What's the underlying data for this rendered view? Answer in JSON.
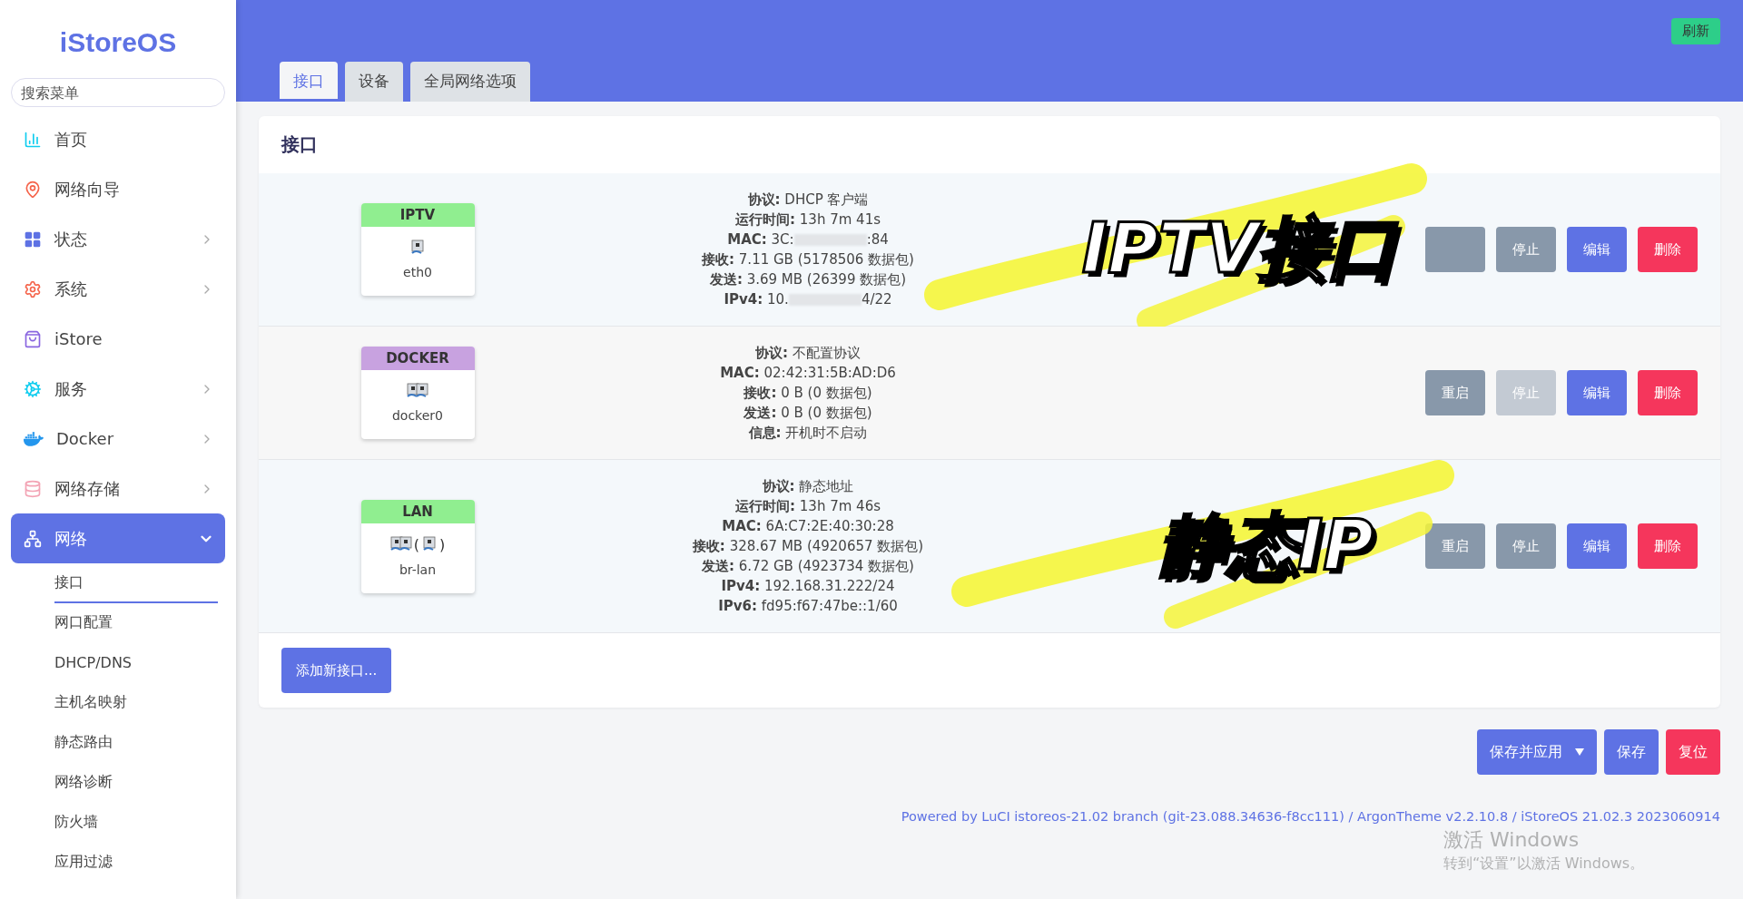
{
  "brand": "iStoreOS",
  "search": {
    "placeholder": "搜索菜单"
  },
  "sidebar": {
    "items": [
      {
        "label": "首页",
        "kind": "home",
        "selected": false
      },
      {
        "label": "网络向导",
        "kind": "wizard",
        "selected": false
      },
      {
        "label": "状态",
        "kind": "status",
        "expanded": false,
        "selected": false
      },
      {
        "label": "系统",
        "kind": "system",
        "expanded": false,
        "selected": false
      },
      {
        "label": "iStore",
        "kind": "store",
        "selected": false
      },
      {
        "label": "服务",
        "kind": "services",
        "expanded": false,
        "selected": false
      },
      {
        "label": "Docker",
        "kind": "docker",
        "expanded": false,
        "selected": false
      },
      {
        "label": "网络存储",
        "kind": "storage",
        "expanded": false,
        "selected": false
      },
      {
        "label": "网络",
        "kind": "network",
        "expanded": true,
        "selected": true,
        "children": [
          {
            "label": "接口",
            "selected": true
          },
          {
            "label": "网口配置",
            "selected": false
          },
          {
            "label": "DHCP/DNS",
            "selected": false
          },
          {
            "label": "主机名映射",
            "selected": false
          },
          {
            "label": "静态路由",
            "selected": false
          },
          {
            "label": "网络诊断",
            "selected": false
          },
          {
            "label": "防火墙",
            "selected": false
          },
          {
            "label": "应用过滤",
            "selected": false
          }
        ]
      }
    ]
  },
  "header": {
    "refresh_button": "刷新"
  },
  "tabs": [
    {
      "label": "接口",
      "selected": true
    },
    {
      "label": "设备",
      "selected": false
    },
    {
      "label": "全局网络选项",
      "selected": false
    }
  ],
  "card": {
    "title": "接口",
    "interfaces": [
      {
        "name": "IPTV",
        "color": "#90ee90",
        "device": "eth0",
        "ports": [
          {
            "kind": "single"
          }
        ],
        "info": [
          {
            "label": "协议:",
            "value": "DHCP 客户端"
          },
          {
            "label": "运行时间:",
            "value": "13h 7m 41s"
          },
          {
            "label": "MAC:",
            "value": "3C:",
            "masked": true,
            "value_end": ":84"
          },
          {
            "label": "接收:",
            "value": "7.11 GB (5178506 数据包)"
          },
          {
            "label": "发送:",
            "value": "3.69 MB (26399 数据包)"
          },
          {
            "label": "IPv4:",
            "value": "10.",
            "masked": true,
            "value_end": "4/22"
          }
        ],
        "buttons": [
          {
            "kind": "restart",
            "disabled": false
          },
          {
            "kind": "stop",
            "label": "停止",
            "disabled": false
          },
          {
            "kind": "edit",
            "label": "编辑",
            "disabled": false
          },
          {
            "kind": "delete",
            "label": "删除",
            "disabled": false
          }
        ],
        "annotation": "IPTV接口"
      },
      {
        "name": "DOCKER",
        "color": "#c8a2e0",
        "device": "docker0",
        "ports": [
          {
            "kind": "double"
          }
        ],
        "info": [
          {
            "label": "协议:",
            "value": "不配置协议"
          },
          {
            "label": "MAC:",
            "value": "02:42:31:5B:AD:D6"
          },
          {
            "label": "接收:",
            "value": "0 B (0 数据包)"
          },
          {
            "label": "发送:",
            "value": "0 B (0 数据包)"
          },
          {
            "label": "信息:",
            "value": "开机时不启动"
          }
        ],
        "buttons": [
          {
            "kind": "restart",
            "label": "重启",
            "disabled": false
          },
          {
            "kind": "stop",
            "label": "停止",
            "disabled": true
          },
          {
            "kind": "edit",
            "label": "编辑",
            "disabled": false
          },
          {
            "kind": "delete",
            "label": "删除",
            "disabled": false
          }
        ]
      },
      {
        "name": "LAN",
        "color": "#90ee90",
        "device": "br-lan",
        "ports": [
          {
            "kind": "double"
          },
          {
            "kind": "single",
            "open": "(",
            "close": ")"
          }
        ],
        "info": [
          {
            "label": "协议:",
            "value": "静态地址"
          },
          {
            "label": "运行时间:",
            "value": "13h 7m 46s"
          },
          {
            "label": "MAC:",
            "value": "6A:C7:2E:40:30:28"
          },
          {
            "label": "接收:",
            "value": "328.67 MB (4920657 数据包)"
          },
          {
            "label": "发送:",
            "value": "6.72 GB (4923734 数据包)"
          },
          {
            "label": "IPv4:",
            "value": "192.168.31.222/24"
          },
          {
            "label": "IPv6:",
            "value": "fd95:f67:47be::1/60"
          }
        ],
        "buttons": [
          {
            "kind": "restart",
            "label": "重启",
            "disabled": false
          },
          {
            "kind": "stop",
            "label": "停止",
            "disabled": false
          },
          {
            "kind": "edit",
            "label": "编辑",
            "disabled": false
          },
          {
            "kind": "delete",
            "label": "删除",
            "disabled": false
          }
        ],
        "annotation": "静态IP"
      }
    ],
    "add_button": "添加新接口..."
  },
  "actions": [
    {
      "kind": "apply",
      "label": "保存并应用",
      "dropdown": true
    },
    {
      "kind": "save",
      "label": "保存"
    },
    {
      "kind": "reset",
      "label": "复位"
    }
  ],
  "footer": "Powered by LuCI istoreos-21.02 branch (git-23.088.34636-f8cc111) / ArgonTheme v2.2.10.8 / iStoreOS 21.02.3 2023060914",
  "activation_notice": [
    "激活 Windows",
    "转到“设置”以激活 Windows。"
  ]
}
